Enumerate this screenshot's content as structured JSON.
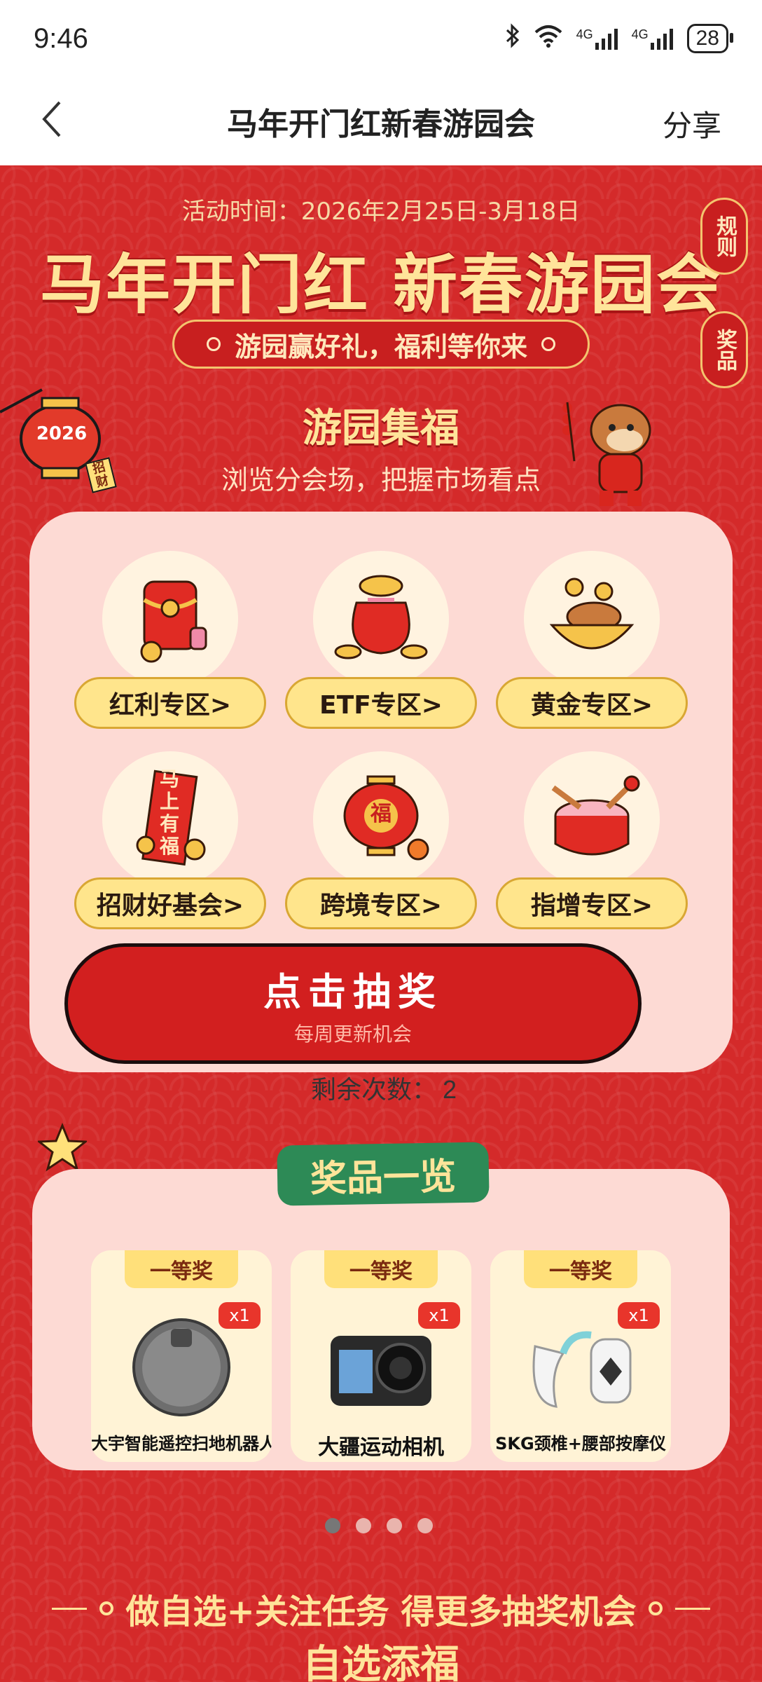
{
  "status_bar": {
    "time": "9:46",
    "network_1": "4G",
    "network_2": "4G",
    "battery": "28"
  },
  "nav": {
    "title": "马年开门红新春游园会",
    "share_label": "分享"
  },
  "hero": {
    "event_time": "活动时间：2026年2月25日-3月18日",
    "headline": "马年开门红 新春游园会",
    "slogan": "游园赢好礼，福利等你来",
    "rules_label": "规则",
    "prizes_label": "奖品",
    "lantern_year": "2026",
    "lantern_tag": "招财"
  },
  "collect": {
    "title": "游园集福",
    "subtitle": "浏览分会场，把握市场看点",
    "zones": [
      {
        "label": "红利专区>"
      },
      {
        "label": "ETF专区>"
      },
      {
        "label": "黄金专区>"
      },
      {
        "label": "招财好基会>"
      },
      {
        "label": "跨境专区>"
      },
      {
        "label": "指增专区>"
      }
    ],
    "scroll_text": "马上有福",
    "lantern_char": "福",
    "draw_button": {
      "label": "点击抽奖",
      "sub": "每周更新机会"
    },
    "remaining_label": "剩余次数：",
    "remaining_value": "2"
  },
  "prizes": {
    "title": "奖品一览",
    "items": [
      {
        "tier": "一等奖",
        "qty": "x1",
        "name": "大宇智能遥控扫地机器人"
      },
      {
        "tier": "一等奖",
        "qty": "x1",
        "name": "大疆运动相机"
      },
      {
        "tier": "一等奖",
        "qty": "x1",
        "name": "SKG颈椎+腰部按摩仪"
      }
    ],
    "pages": 4,
    "active_page": 1
  },
  "task": {
    "banner": "做自选+关注任务 得更多抽奖机会",
    "next_title": "自选添福"
  },
  "colors": {
    "page_red": "#d42a2a",
    "gold": "#ffe49a",
    "card_pink": "#fddad4",
    "green": "#2d8a56"
  }
}
